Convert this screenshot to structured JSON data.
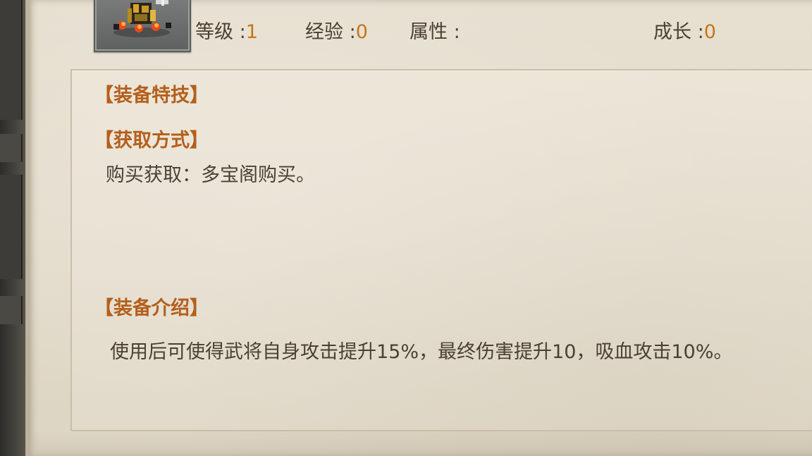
{
  "stats": {
    "level_label": "等级 :",
    "level_value": "1",
    "exp_label": "经验 :",
    "exp_value": "0",
    "attr_label": "属性 :",
    "growth_label": "成长 :",
    "growth_value": "0"
  },
  "avatar": {
    "icon": "warrior-portrait-icon"
  },
  "sections": {
    "skill_title": "【装备特技】",
    "obtain_title": "【获取方式】",
    "obtain_text": "购买获取：多宝阁购买。",
    "intro_title": "【装备介绍】",
    "intro_text": "使用后可使得武将自身攻击提升15%，最终伤害提升10，吸血攻击10%。"
  },
  "colors": {
    "label_text": "#4a3f33",
    "value_accent": "#c8741c",
    "section_title": "#b45f1c",
    "parchment": "#e3dccc"
  }
}
